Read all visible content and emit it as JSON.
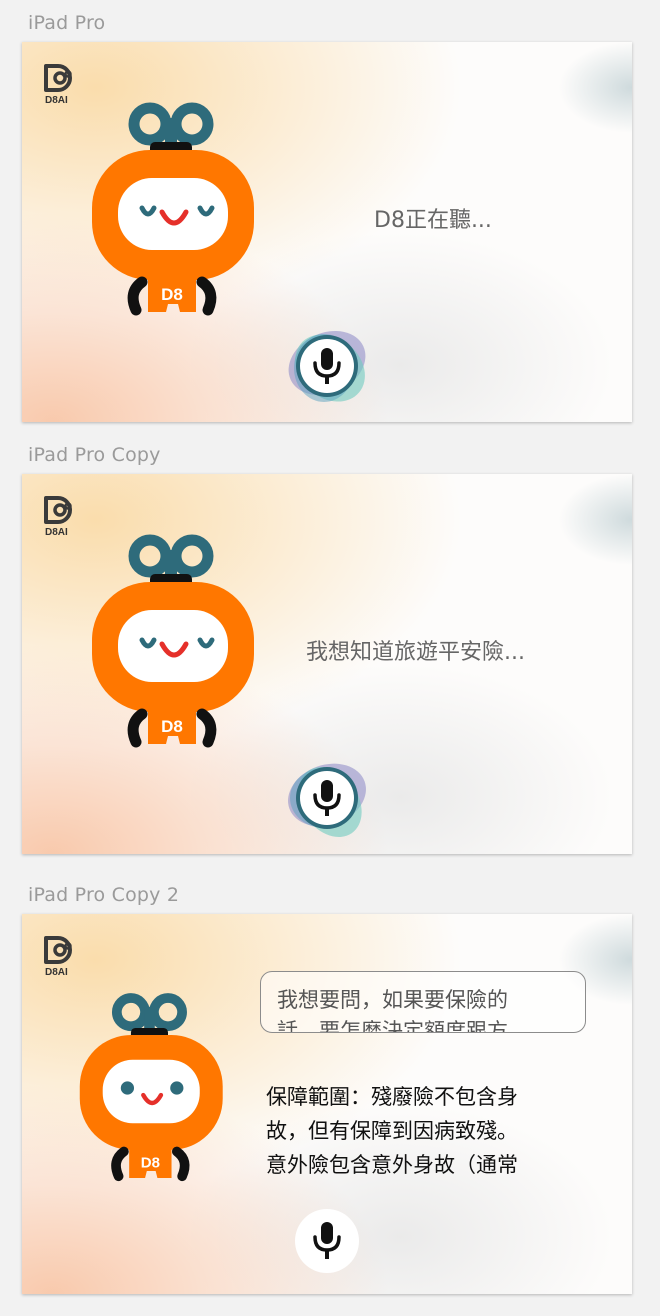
{
  "frames": [
    {
      "label": "iPad Pro",
      "logo_text": "D8AI",
      "robot_badge": "D8",
      "status_text": "D8正在聽..."
    },
    {
      "label": "iPad Pro Copy",
      "logo_text": "D8AI",
      "robot_badge": "D8",
      "status_text": "我想知道旅遊平安險..."
    },
    {
      "label": "iPad Pro Copy 2",
      "logo_text": "D8AI",
      "robot_badge": "D8",
      "question_lines": [
        "我想要問，如果要保險的",
        "話，要怎麼決定額度跟方"
      ],
      "answer_lines": [
        "保障範圍：殘廢險不包含身",
        "故，但有保障到因病致殘。",
        "意外險包含意外身故（通常"
      ]
    }
  ],
  "colors": {
    "robot_orange": "#FF7700",
    "robot_teal": "#2E6B7B",
    "robot_mouth": "#E5302A",
    "logo_dark": "#3a3a3a",
    "mic_ring": "#2E6B7B"
  },
  "icons": [
    "d8ai-logo-icon",
    "robot-mascot-icon",
    "microphone-icon"
  ]
}
